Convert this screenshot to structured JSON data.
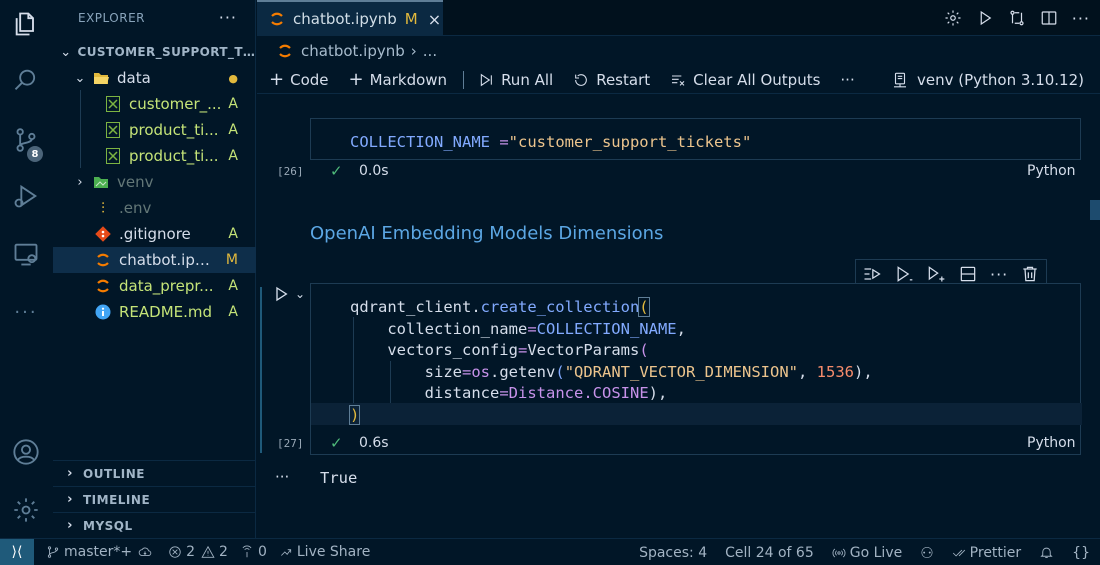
{
  "sidebar": {
    "title": "EXPLORER",
    "project": "CUSTOMER_SUPPORT_TI...",
    "items": [
      {
        "label": "data",
        "status": "●"
      },
      {
        "label": "customer_...",
        "status": "A"
      },
      {
        "label": "product_ti...",
        "status": "A"
      },
      {
        "label": "product_ti...",
        "status": "A"
      },
      {
        "label": "venv",
        "status": ""
      },
      {
        "label": ".env",
        "status": ""
      },
      {
        "label": ".gitignore",
        "status": "A"
      },
      {
        "label": "chatbot.ipy...",
        "status": "M"
      },
      {
        "label": "data_prepr...",
        "status": "A"
      },
      {
        "label": "README.md",
        "status": "A"
      }
    ],
    "sections": [
      "OUTLINE",
      "TIMELINE",
      "MYSQL"
    ]
  },
  "activity": {
    "scm_badge": "8"
  },
  "tab": {
    "name": "chatbot.ipynb",
    "status": "M",
    "close": "×"
  },
  "breadcrumb": {
    "file": "chatbot.ipynb",
    "rest": "..."
  },
  "toolbar": {
    "code": "Code",
    "markdown": "Markdown",
    "run_all": "Run All",
    "restart": "Restart",
    "clear": "Clear All Outputs",
    "more": "···",
    "kernel": "venv (Python 3.10.12)"
  },
  "cells": {
    "c1": {
      "var": "COLLECTION_NAME",
      "eq": " =",
      "str": "\"customer_support_tickets\"",
      "exec": "[26]",
      "time": "0.0s",
      "lang": "Python"
    },
    "markdown": "OpenAI Embedding Models Dimensions",
    "c2": {
      "l1a": "qdrant_client.",
      "l1b": "create_collection",
      "l1c": "(",
      "l2a": "collection_name",
      "l2b": "=",
      "l2c": "COLLECTION_NAME",
      "l2d": ",",
      "l3a": "vectors_config",
      "l3b": "=",
      "l3c": "VectorParams",
      "l3d": "(",
      "l4a": "size",
      "l4b": "=",
      "l4c": "os",
      "l4d": ".",
      "l4e": "getenv",
      "l4f": "(",
      "l4g": "\"QDRANT_VECTOR_DIMENSION\"",
      "l4h": ", ",
      "l4i": "1536",
      "l4j": "),",
      "l5a": "distance",
      "l5b": "=",
      "l5c": "Distance",
      "l5d": ".",
      "l5e": "COSINE",
      "l5f": "),",
      "l6": ")",
      "exec": "[27]",
      "time": "0.6s",
      "lang": "Python",
      "output": "True",
      "output_dots": "···"
    }
  },
  "status": {
    "branch": "master*+",
    "errors": "2",
    "warnings": "2",
    "ports": "0",
    "live_share": "Live Share",
    "spaces": "Spaces: 4",
    "cell": "Cell 24 of 65",
    "go_live": "Go Live",
    "prettier": "Prettier"
  }
}
